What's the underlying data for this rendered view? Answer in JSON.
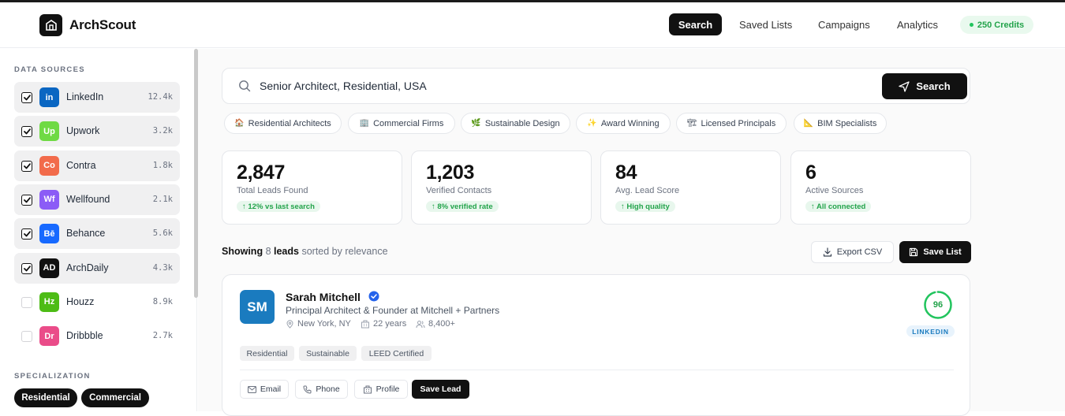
{
  "app": {
    "brand": "ArchScout"
  },
  "nav": {
    "items": [
      {
        "label": "Search",
        "active": true
      },
      {
        "label": "Saved Lists"
      },
      {
        "label": "Campaigns"
      },
      {
        "label": "Analytics"
      }
    ],
    "credits": "250 Credits"
  },
  "sidebar": {
    "data_sources_title": "DATA SOURCES",
    "sources": [
      {
        "abbr": "in",
        "name": "LinkedIn",
        "count": "12.4k",
        "checked": true,
        "color": "#0a66c2"
      },
      {
        "abbr": "Up",
        "name": "Upwork",
        "count": "3.2k",
        "checked": true,
        "color": "#6fda44"
      },
      {
        "abbr": "Co",
        "name": "Contra",
        "count": "1.8k",
        "checked": true,
        "color": "#f26b4b"
      },
      {
        "abbr": "Wf",
        "name": "Wellfound",
        "count": "2.1k",
        "checked": true,
        "color": "#8b5cf6"
      },
      {
        "abbr": "Bē",
        "name": "Behance",
        "count": "5.6k",
        "checked": true,
        "color": "#1769ff"
      },
      {
        "abbr": "AD",
        "name": "ArchDaily",
        "count": "4.3k",
        "checked": true,
        "color": "#111111"
      },
      {
        "abbr": "Hz",
        "name": "Houzz",
        "count": "8.9k",
        "checked": false,
        "color": "#4dbc15"
      },
      {
        "abbr": "Dr",
        "name": "Dribbble",
        "count": "2.7k",
        "checked": false,
        "color": "#ea4c89"
      }
    ],
    "specialization_title": "SPECIALIZATION",
    "specializations": [
      "Residential",
      "Commercial"
    ]
  },
  "search": {
    "query": "Senior Architect, Residential, USA",
    "button": "Search"
  },
  "chips": [
    {
      "icon": "🏠",
      "label": "Residential Architects"
    },
    {
      "icon": "🏢",
      "label": "Commercial Firms"
    },
    {
      "icon": "🌿",
      "label": "Sustainable Design"
    },
    {
      "icon": "✨",
      "label": "Award Winning"
    },
    {
      "icon": "🏗",
      "label": "Licensed Principals"
    },
    {
      "icon": "📐",
      "label": "BIM Specialists"
    }
  ],
  "stats": [
    {
      "value": "2,847",
      "label": "Total Leads Found",
      "badge": "↑ 12% vs last search"
    },
    {
      "value": "1,203",
      "label": "Verified Contacts",
      "badge": "↑ 8% verified rate"
    },
    {
      "value": "84",
      "label": "Avg. Lead Score",
      "badge": "↑ High quality"
    },
    {
      "value": "6",
      "label": "Active Sources",
      "badge": "↑ All connected"
    }
  ],
  "results": {
    "showing_prefix": "Showing",
    "count": "8",
    "leads_word": "leads",
    "suffix": "sorted by relevance",
    "export_label": "Export CSV",
    "save_list_label": "Save List"
  },
  "lead": {
    "initials": "SM",
    "name": "Sarah Mitchell",
    "title": "Principal Architect & Founder at Mitchell + Partners",
    "location": "New York, NY",
    "experience": "22 years",
    "followers": "8,400+",
    "tags": [
      "Residential",
      "Sustainable",
      "LEED Certified"
    ],
    "score": "96",
    "score_fraction": 0.96,
    "source": "LINKEDIN",
    "actions": {
      "email": "Email",
      "phone": "Phone",
      "profile": "Profile",
      "save": "Save Lead"
    }
  }
}
